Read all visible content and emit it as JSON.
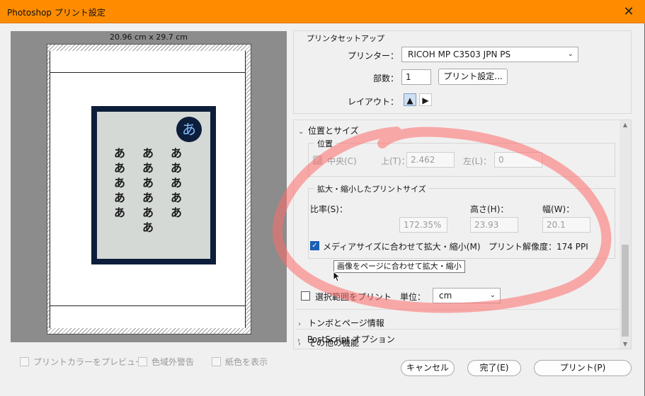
{
  "window": {
    "title": "Photoshop プリント設定",
    "close_glyph": "✕"
  },
  "preview": {
    "paper_size": "20.96 cm x 29.7 cm",
    "badge_char": "あ",
    "kana": [
      "あ",
      "あ",
      "あ",
      "あ",
      "あ"
    ],
    "kana_col2": [
      "あ",
      "あ",
      "あ",
      "あ",
      "あ",
      "あ"
    ],
    "options": [
      {
        "label": "プリントカラーをプレビュー"
      },
      {
        "label": "色域外警告"
      },
      {
        "label": "紙色を表示"
      }
    ]
  },
  "printer_setup": {
    "title": "プリンタセットアップ",
    "printer_label": "プリンター：",
    "printer_value": "RICOH MP C3503 JPN PS",
    "copies_label": "部数：",
    "copies_value": "1",
    "print_settings_button": "プリント設定...",
    "layout_label": "レイアウト："
  },
  "position_size": {
    "header": "位置とサイズ",
    "position_group": "位置",
    "center_label": "中央(C)",
    "top_label": "上(T)：",
    "top_value": "2.462",
    "left_label": "左(L)：",
    "left_value": "0",
    "scaled_group": "拡大・縮小したプリントサイズ",
    "scale_label": "比率(S)：",
    "scale_value": "172.35%",
    "height_label": "高さ(H)：",
    "height_value": "23.93",
    "width_label": "幅(W)：",
    "width_value": "20.1",
    "fit_media_label": "メディアサイズに合わせて拡大・縮小(M)",
    "resolution_text": "プリント解像度：174 PPI",
    "selection_label": "選択範囲をプリント",
    "unit_label": "単位：",
    "unit_value": "cm",
    "tooltip": "画像をページに合わせて拡大・縮小"
  },
  "sections": [
    {
      "label": "トンボとページ情報"
    },
    {
      "label": "その他の機能"
    },
    {
      "label": "PostScript オプション"
    }
  ],
  "footer": {
    "cancel": "キャンセル",
    "done": "完了(E)",
    "print": "プリント(P)"
  },
  "colors": {
    "titlebar": "#ff8c00",
    "accent": "#1a5fb4",
    "highlight_stroke": "#ff6b6b"
  }
}
